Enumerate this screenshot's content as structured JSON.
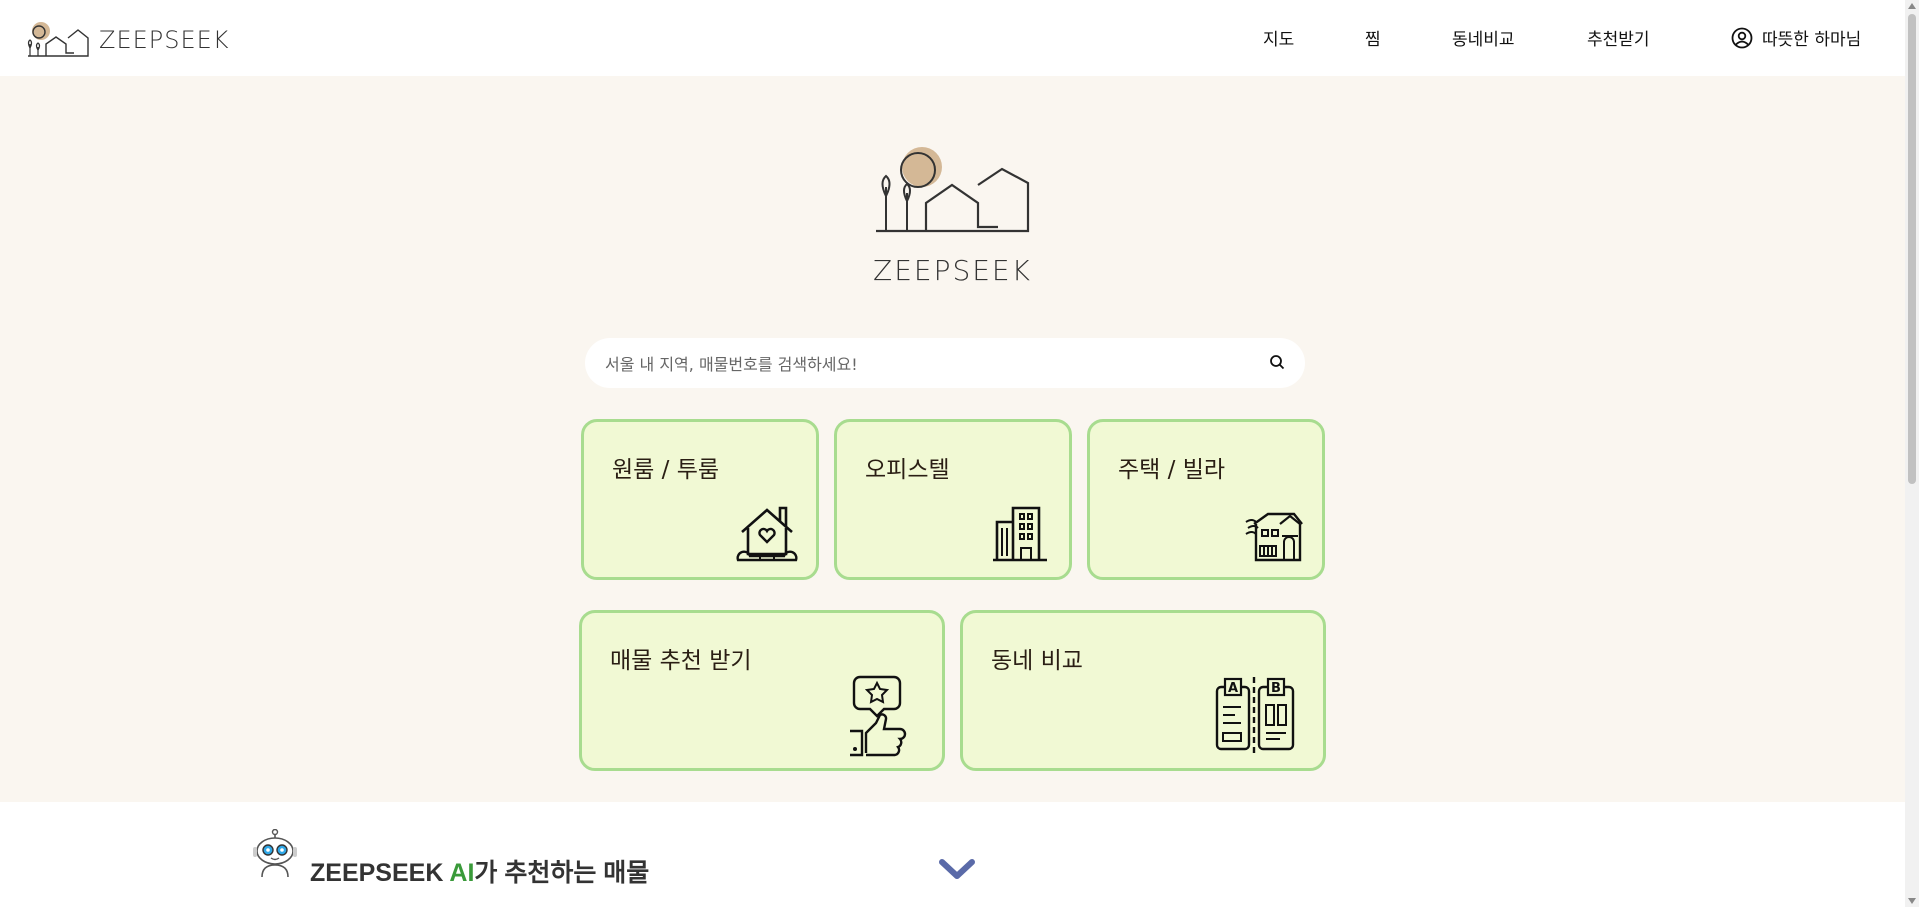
{
  "header": {
    "brand": "ZEEPSEEK",
    "nav": [
      {
        "label": "지도"
      },
      {
        "label": "찜"
      },
      {
        "label": "동네비교"
      },
      {
        "label": "추천받기"
      }
    ],
    "user_name": "따뜻한 하마님"
  },
  "hero": {
    "brand": "ZEEPSEEK",
    "search_placeholder": "서울 내 지역, 매물번호를 검색하세요!",
    "search_value": ""
  },
  "cards": [
    {
      "label": "원룸 / 투룸",
      "icon": "house-heart-icon"
    },
    {
      "label": "오피스텔",
      "icon": "office-building-icon"
    },
    {
      "label": "주택 / 빌라",
      "icon": "villa-house-icon"
    },
    {
      "label": "매물 추천 받기",
      "icon": "thumbs-up-star-icon"
    },
    {
      "label": "동네 비교",
      "icon": "compare-ab-icon"
    }
  ],
  "recommend": {
    "title_prefix": "ZEEPSEEK ",
    "title_ai": "AI",
    "title_suffix": "가 추천하는 매물"
  },
  "colors": {
    "hero_bg": "#faf6f0",
    "card_bg": "#f1f9d4",
    "card_border": "#a8dc8f",
    "logo_sun": "#d4b896",
    "ai_green": "#3a9a3a",
    "chevron": "#5a6aa8"
  }
}
